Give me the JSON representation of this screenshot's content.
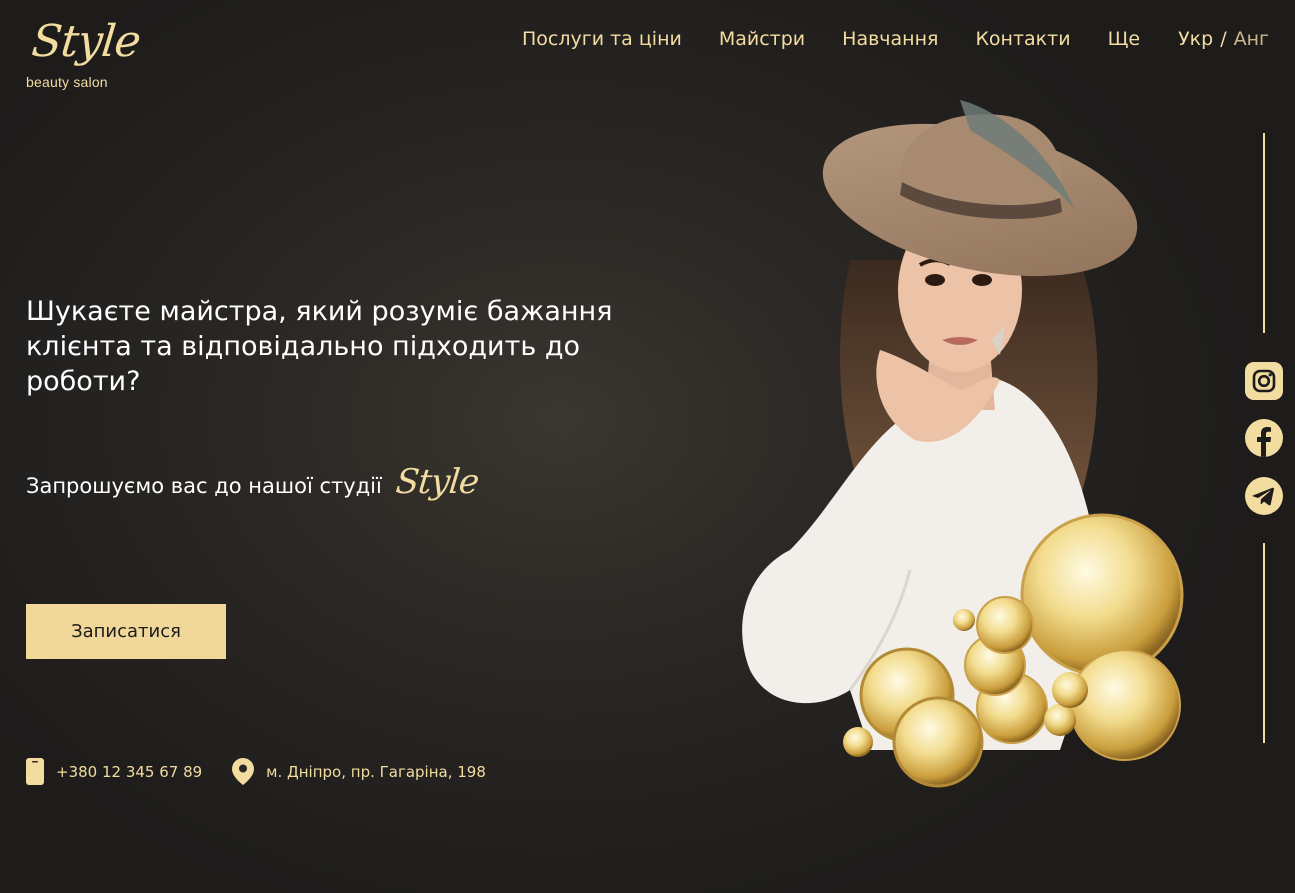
{
  "logo": {
    "script": "Style",
    "subtitle": "beauty salon"
  },
  "nav": {
    "items": [
      {
        "label": "Послуги та ціни"
      },
      {
        "label": "Майстри"
      },
      {
        "label": "Навчання"
      },
      {
        "label": "Контакти"
      },
      {
        "label": "Ще"
      }
    ],
    "lang_active": "Укр",
    "lang_separator": "/",
    "lang_other": "Анг"
  },
  "hero": {
    "headline": "Шукаєте майстра, який розуміє бажання клієнта та відповідально підходить до роботи?",
    "invite": "Запрошуємо вас до нашої студії",
    "brand": "Style",
    "cta_label": "Записатися"
  },
  "contacts": {
    "phone": "+380 12 345 67 89",
    "address": "м. Дніпро, пр. Гагаріна, 198"
  },
  "social": [
    "instagram-icon",
    "facebook-icon",
    "telegram-icon"
  ],
  "colors": {
    "accent": "#f3dca0",
    "button": "#f1d79a",
    "background": "#1d1c1b"
  }
}
